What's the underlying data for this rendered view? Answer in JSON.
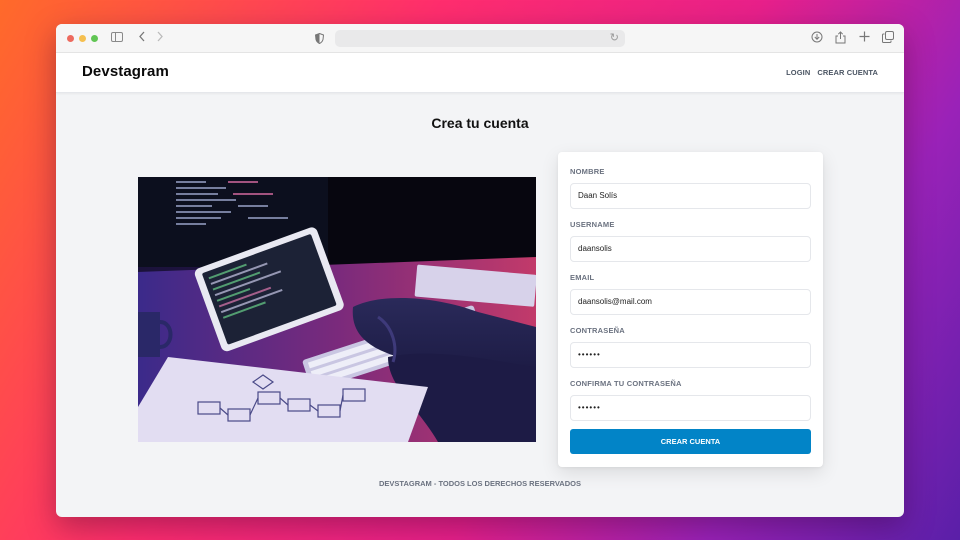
{
  "browser": {
    "address_value": ""
  },
  "navbar": {
    "brand": "Devstagram",
    "links": [
      "LOGIN",
      "CREAR CUENTA"
    ]
  },
  "main": {
    "title": "Crea tu cuenta",
    "hero_image": "developer-at-laptop-photo"
  },
  "form": {
    "fields": [
      {
        "label": "NOMBRE",
        "value": "Daan Solís"
      },
      {
        "label": "USERNAME",
        "value": "daansolis"
      },
      {
        "label": "EMAIL",
        "value": "daansolis@mail.com"
      },
      {
        "label": "CONTRASEÑA",
        "value": "••••••"
      },
      {
        "label": "CONFIRMA TU CONTRASEÑA",
        "value": "••••••"
      }
    ],
    "submit_label": "CREAR CUENTA",
    "submit_color": "#0284c7"
  },
  "footer": {
    "text": "DEVSTAGRAM - TODOS LOS DERECHOS RESERVADOS"
  }
}
